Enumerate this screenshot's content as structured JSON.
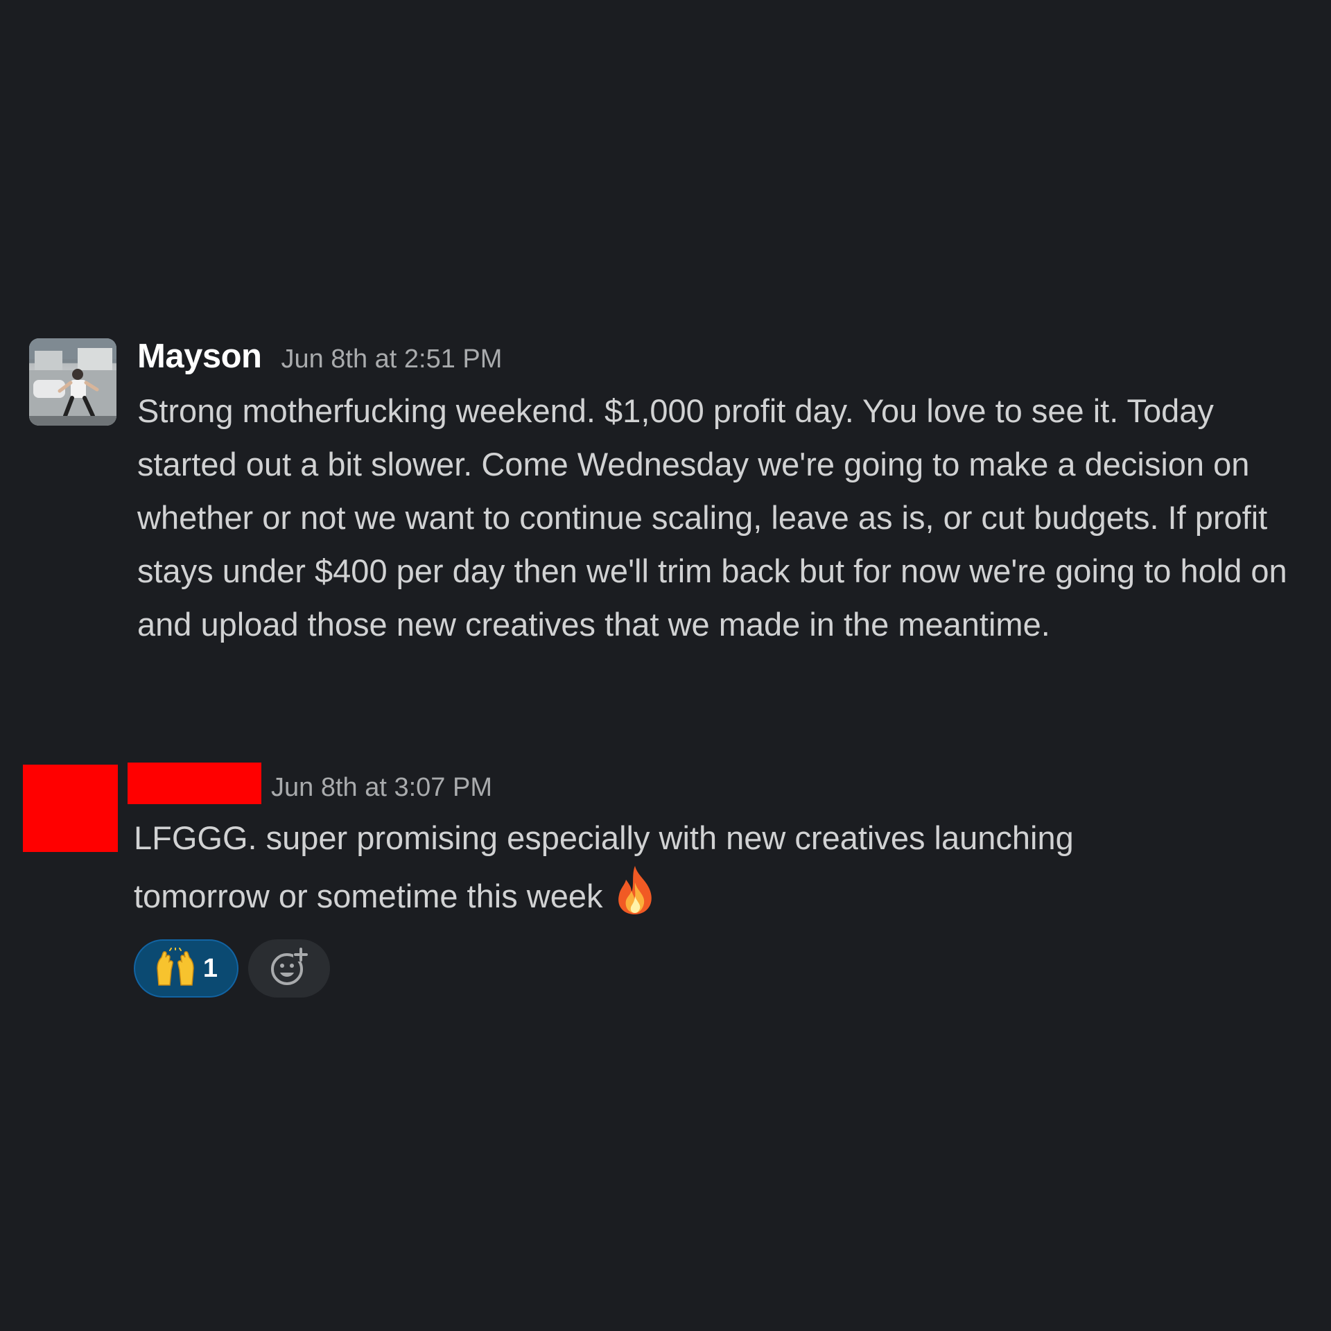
{
  "messages": [
    {
      "author": "Mayson",
      "timestamp": "Jun 8th at 2:51 PM",
      "text": "Strong motherfucking weekend. $1,000 profit day. You love to see it. Today started out a bit slower. Come Wednesday we're going to make a decision on whether or not we want to continue scaling, leave as is, or cut budgets. If profit stays under $400 per day then we'll trim back but for now we're going to hold on and upload those new creatives that we made in the meantime.",
      "avatar": "photo"
    },
    {
      "author": "",
      "timestamp": "Jun 8th at 3:07 PM",
      "text": "LFGGG. super promising especially with new creatives launching tomorrow or sometime this week",
      "trailing_emoji": "fire-icon",
      "avatar": "redacted",
      "reactions": [
        {
          "emoji": "raised-hands-icon",
          "count": "1",
          "selected": true
        }
      ],
      "add_reaction_icon": "add-reaction-icon"
    }
  ],
  "colors": {
    "background": "#1b1d21",
    "text": "#d1d2d3",
    "author": "#ffffff",
    "timestamp": "#a9abad",
    "reaction_selected_bg": "#0b4a72",
    "reaction_selected_border": "#1264a3",
    "redaction": "#ff0000"
  }
}
